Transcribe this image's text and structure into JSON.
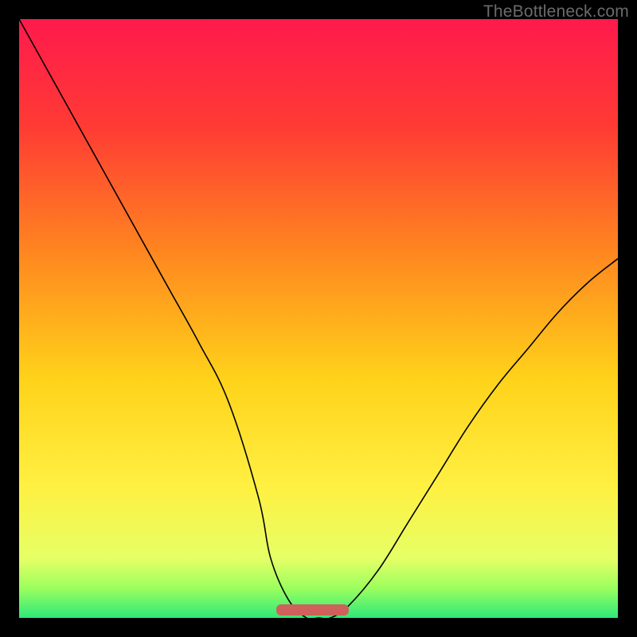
{
  "watermark": "TheBottleneck.com",
  "colors": {
    "frame": "#000000",
    "watermark_text": "#6b6b6b",
    "valley_marker": "#cf605c",
    "gradient_stops": [
      {
        "pct": 0,
        "color": "#ff1a4d"
      },
      {
        "pct": 18,
        "color": "#ff3b34"
      },
      {
        "pct": 40,
        "color": "#ff8a1f"
      },
      {
        "pct": 60,
        "color": "#ffd21a"
      },
      {
        "pct": 78,
        "color": "#fff042"
      },
      {
        "pct": 90,
        "color": "#e6ff66"
      },
      {
        "pct": 95,
        "color": "#9cff5e"
      },
      {
        "pct": 100,
        "color": "#2ee87a"
      }
    ]
  },
  "chart_data": {
    "type": "line",
    "title": "",
    "xlabel": "",
    "ylabel": "",
    "x": [
      0,
      5,
      10,
      15,
      20,
      25,
      30,
      35,
      40,
      42,
      45,
      48,
      50,
      52,
      55,
      60,
      65,
      70,
      75,
      80,
      85,
      90,
      95,
      100
    ],
    "values": [
      100,
      91,
      82,
      73,
      64,
      55,
      46,
      36,
      20,
      10,
      3,
      0,
      0,
      0,
      2,
      8,
      16,
      24,
      32,
      39,
      45,
      51,
      56,
      60
    ],
    "xlim": [
      0,
      100
    ],
    "ylim": [
      0,
      100
    ],
    "valley_flat_range_x": [
      43,
      55
    ],
    "annotations": [
      "TheBottleneck.com"
    ]
  }
}
